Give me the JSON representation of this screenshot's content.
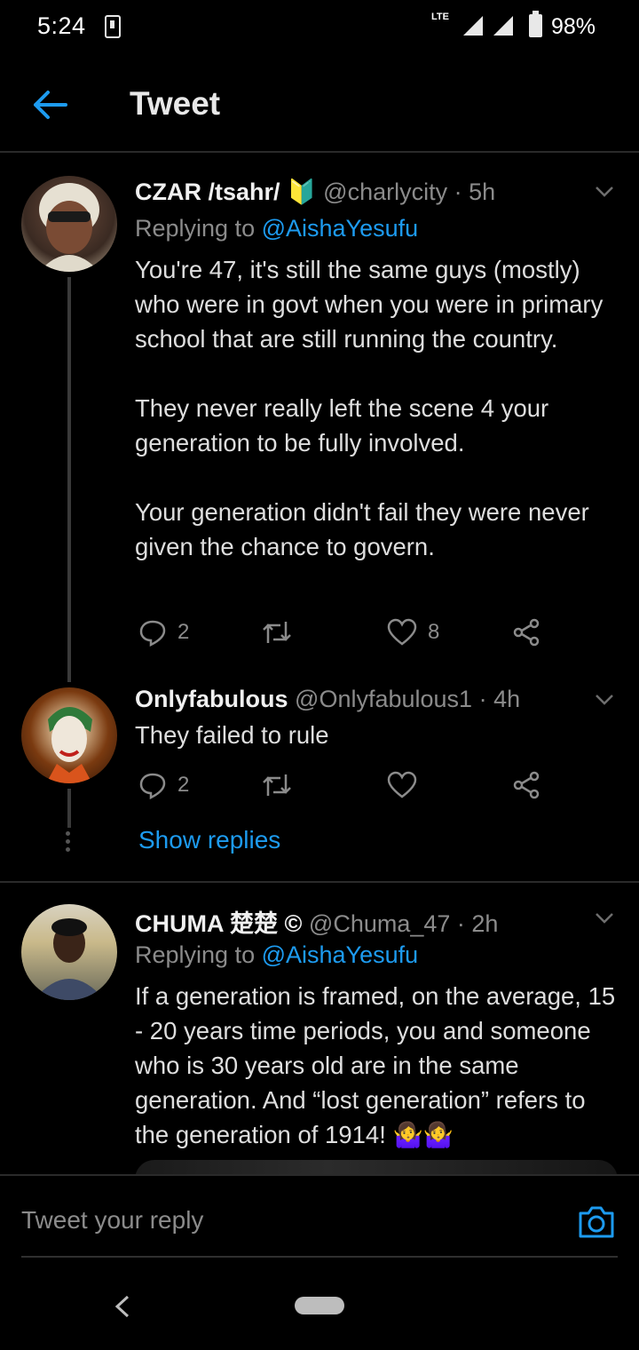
{
  "status_bar": {
    "time": "5:24",
    "network": "LTE",
    "battery": "98%"
  },
  "header": {
    "title": "Tweet"
  },
  "tweets": [
    {
      "name": "CZAR /tsahr/ 🔰",
      "handle": "@charlycity",
      "time": "· 5h",
      "replying_prefix": "Replying to ",
      "replying_to": "@AishaYesufu",
      "text": "You're 47, it's still the same guys (mostly) who were in govt when you were in primary school that are still running the country.\n\nThey never really left the scene 4 your generation to be fully involved.\n\nYour generation didn't fail they were never given the chance to govern.",
      "replies": "2",
      "retweets": "",
      "likes": "8"
    },
    {
      "name": "Onlyfabulous",
      "handle": "@Onlyfabulous1",
      "time": "· 4h",
      "text": "They failed to rule",
      "replies": "2",
      "retweets": "",
      "likes": ""
    },
    {
      "name": "CHUMA 楚楚 ©",
      "handle": "@Chuma_47",
      "time": "· 2h",
      "replying_prefix": "Replying to ",
      "replying_to": "@AishaYesufu",
      "text": "If a generation is framed, on the average, 15 - 20 years time periods, you and someone who is 30 years old are in the same generation. And “lost generation” refers to the generation of 1914! 🤷‍♀️🤷‍♀️"
    }
  ],
  "show_replies_label": "Show replies",
  "reply_box": {
    "placeholder": "Tweet your reply"
  },
  "colors": {
    "accent": "#1d9bf0",
    "background": "#000000",
    "muted": "#8b8b8b"
  }
}
